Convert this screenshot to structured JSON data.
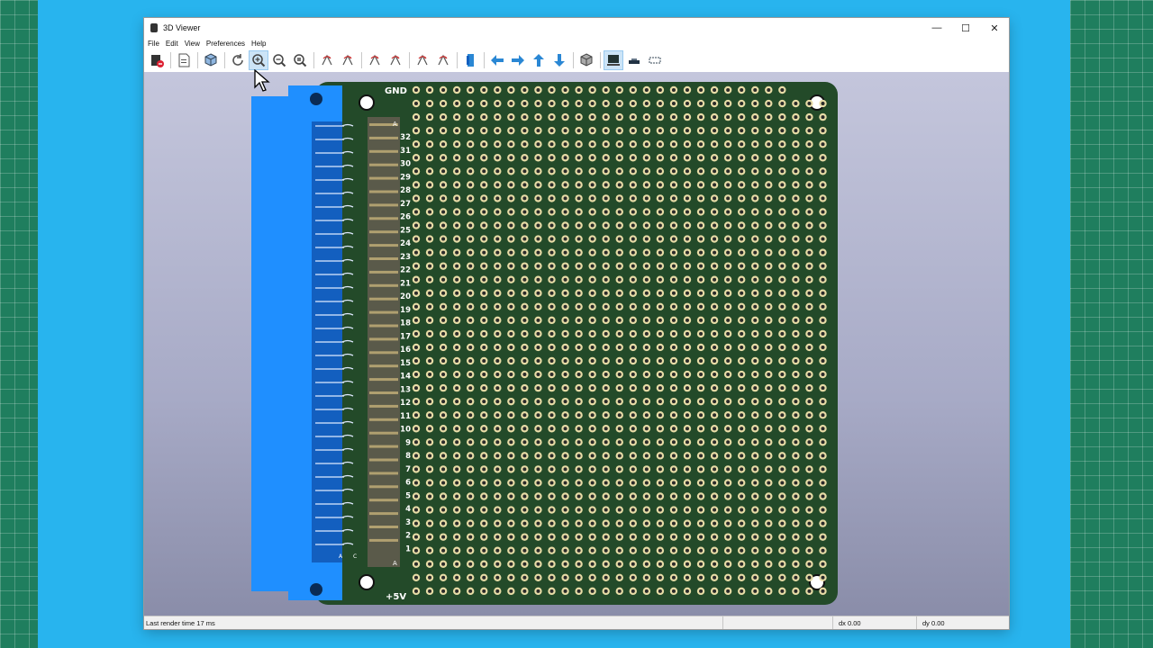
{
  "window": {
    "title": "3D Viewer",
    "controls": {
      "minimize": "—",
      "maximize": "☐",
      "close": "✕"
    }
  },
  "menu": [
    {
      "label": "File",
      "accel": "F"
    },
    {
      "label": "Edit",
      "accel": "E"
    },
    {
      "label": "View",
      "accel": "V"
    },
    {
      "label": "Preferences",
      "accel": "P"
    },
    {
      "label": "Help",
      "accel": "H"
    }
  ],
  "toolbar": [
    {
      "name": "close-viewer",
      "icon": "exit-icon"
    },
    {
      "sep": true
    },
    {
      "name": "export-image",
      "icon": "export-file-icon"
    },
    {
      "sep": true
    },
    {
      "name": "render-toggle",
      "icon": "3d-cube-icon"
    },
    {
      "sep": true
    },
    {
      "name": "reload",
      "icon": "refresh-icon"
    },
    {
      "name": "zoom-in",
      "icon": "zoom-in-icon",
      "active": true
    },
    {
      "name": "zoom-out",
      "icon": "zoom-out-icon"
    },
    {
      "name": "zoom-fit",
      "icon": "zoom-fit-icon"
    },
    {
      "sep": true
    },
    {
      "name": "rotate-x-cw",
      "icon": "rotate-x-cw-icon"
    },
    {
      "name": "rotate-x-ccw",
      "icon": "rotate-x-ccw-icon"
    },
    {
      "sep": true
    },
    {
      "name": "rotate-y-cw",
      "icon": "rotate-y-cw-icon"
    },
    {
      "name": "rotate-y-ccw",
      "icon": "rotate-y-ccw-icon"
    },
    {
      "sep": true
    },
    {
      "name": "rotate-z-cw",
      "icon": "rotate-z-cw-icon"
    },
    {
      "name": "rotate-z-ccw",
      "icon": "rotate-z-ccw-icon"
    },
    {
      "sep": true
    },
    {
      "name": "flip-board",
      "icon": "flip-board-icon"
    },
    {
      "sep": true
    },
    {
      "name": "pan-left",
      "icon": "arrow-left-icon"
    },
    {
      "name": "pan-right",
      "icon": "arrow-right-icon"
    },
    {
      "name": "pan-up",
      "icon": "arrow-up-icon"
    },
    {
      "name": "pan-down",
      "icon": "arrow-down-icon"
    },
    {
      "sep": true
    },
    {
      "name": "toggle-ortho",
      "icon": "ortho-cube-icon"
    },
    {
      "sep": true
    },
    {
      "name": "toggle-body",
      "icon": "board-body-icon",
      "active": true
    },
    {
      "name": "toggle-silk",
      "icon": "board-silk-icon"
    },
    {
      "name": "toggle-outline",
      "icon": "board-outline-icon"
    }
  ],
  "board": {
    "top_label": "GND",
    "bottom_label": "+5V",
    "row_labels": [
      "32",
      "31",
      "30",
      "29",
      "28",
      "27",
      "26",
      "25",
      "24",
      "23",
      "22",
      "21",
      "20",
      "19",
      "18",
      "17",
      "16",
      "15",
      "14",
      "13",
      "12",
      "11",
      "10",
      "9",
      "8",
      "7",
      "6",
      "5",
      "4",
      "3",
      "2",
      "1"
    ],
    "col_label_top": "A",
    "col_label_bottom": "A",
    "connector_labels": [
      "A",
      "C"
    ],
    "colors": {
      "pcb": "#234a29",
      "pad": "#e7dca6",
      "connector": "#1f8fff",
      "connector_dark": "#135fbf"
    }
  },
  "status": {
    "message": "Last render time 17 ms",
    "dx": "dx 0.00",
    "dy": "dy 0.00"
  }
}
